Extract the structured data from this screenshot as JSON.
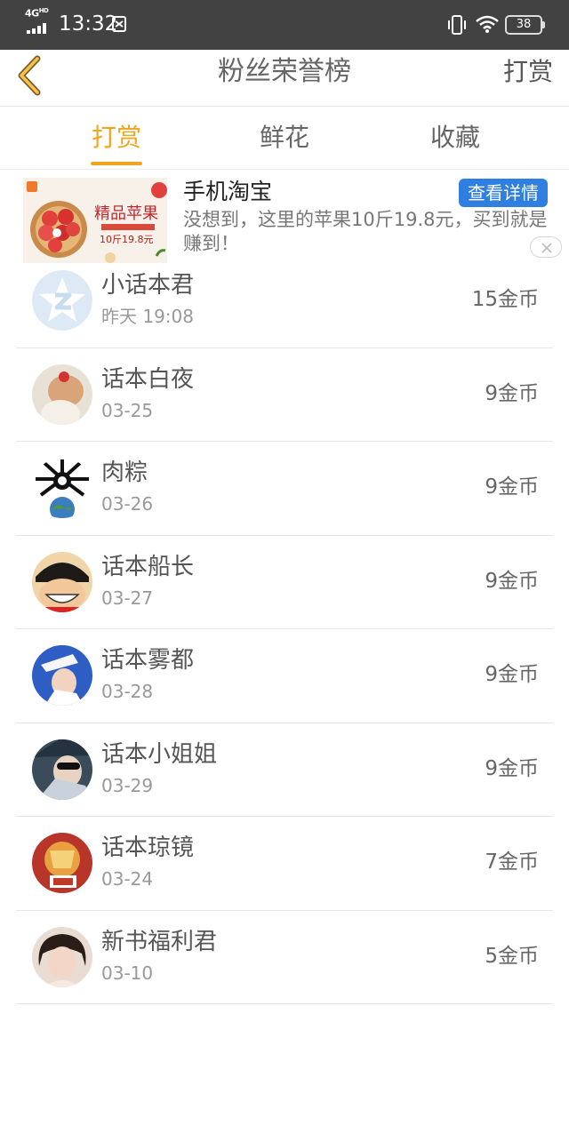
{
  "status_bar": {
    "network": "4G",
    "network_hd": "HD",
    "time": "13:32",
    "battery": "38"
  },
  "header": {
    "title": "粉丝荣誉榜",
    "action": "打赏"
  },
  "tabs": [
    {
      "label": "打赏",
      "active": true
    },
    {
      "label": "鲜花",
      "active": false
    },
    {
      "label": "收藏",
      "active": false
    }
  ],
  "ad": {
    "title": "手机淘宝",
    "button": "查看详情",
    "description": "没想到，这里的苹果10斤19.8元，买到就是赚到！",
    "image_text_main": "精品苹果",
    "image_text_price": "10斤19.8元"
  },
  "fans": [
    {
      "name": "小话本君",
      "date": "昨天 19:08",
      "coins": "15金币",
      "avatar": "default-avatar-icon"
    },
    {
      "name": "话本白夜",
      "date": "03-25",
      "coins": "9金币",
      "avatar": "photo-avatar"
    },
    {
      "name": "肉粽",
      "date": "03-26",
      "coins": "9金币",
      "avatar": "photo-avatar"
    },
    {
      "name": "话本船长",
      "date": "03-27",
      "coins": "9金币",
      "avatar": "photo-avatar"
    },
    {
      "name": "话本雾都",
      "date": "03-28",
      "coins": "9金币",
      "avatar": "photo-avatar"
    },
    {
      "name": "话本小姐姐",
      "date": "03-29",
      "coins": "9金币",
      "avatar": "photo-avatar"
    },
    {
      "name": "话本琼镜",
      "date": "03-24",
      "coins": "7金币",
      "avatar": "photo-avatar"
    },
    {
      "name": "新书福利君",
      "date": "03-10",
      "coins": "5金币",
      "avatar": "photo-avatar"
    }
  ],
  "colors": {
    "accent": "#f0a51e",
    "ad_button": "#2f7fe0",
    "status_bar": "#424242"
  }
}
